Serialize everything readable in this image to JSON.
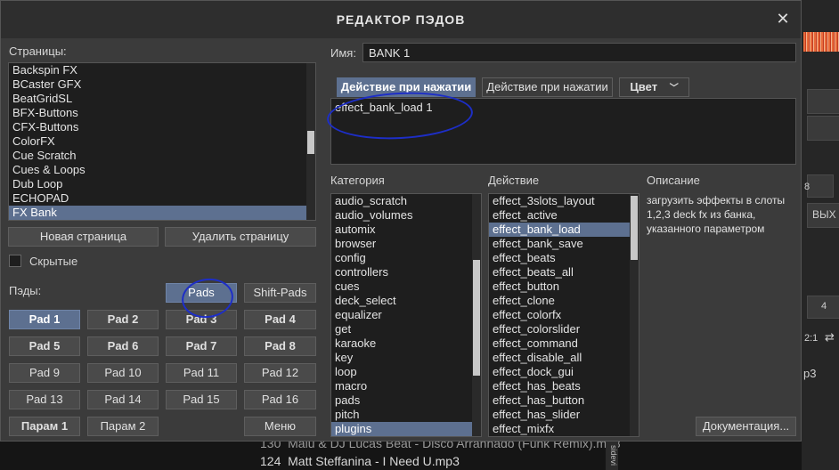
{
  "dialog": {
    "title": "РЕДАКТОР ПЭДОВ",
    "close_label": "✕"
  },
  "pages": {
    "label": "Страницы:",
    "items": [
      "Backspin FX",
      "BCaster GFX",
      "BeatGridSL",
      "BFX-Buttons",
      "CFX-Buttons",
      "ColorFX",
      "Cue Scratch",
      "Cues & Loops",
      "Dub Loop",
      "ECHOPAD",
      "FX Bank"
    ],
    "selected": "FX Bank",
    "new_page_label": "Новая страница",
    "delete_page_label": "Удалить страницу",
    "hidden_label": "Скрытые",
    "hidden_checked": false
  },
  "pads": {
    "label": "Пэды:",
    "mode_tabs": [
      "Pads",
      "Shift-Pads"
    ],
    "mode_selected": "Pads",
    "buttons": [
      "Pad 1",
      "Pad 2",
      "Pad 3",
      "Pad 4",
      "Pad 5",
      "Pad 6",
      "Pad 7",
      "Pad 8",
      "Pad 9",
      "Pad 10",
      "Pad 11",
      "Pad 12",
      "Pad 13",
      "Pad 14",
      "Pad 15",
      "Pad 16"
    ],
    "selected": "Pad 1",
    "param_label": "Парам 1",
    "param2_label": "Парам 2",
    "menu_label": "Меню"
  },
  "editor": {
    "name_label": "Имя:",
    "name_value": "BANK 1",
    "action_tabs": [
      "Действие при нажатии",
      "Действие при нажатии"
    ],
    "color_label": "Цвет",
    "script": "effect_bank_load 1"
  },
  "category": {
    "label": "Категория",
    "items": [
      "audio_scratch",
      "audio_volumes",
      "automix",
      "browser",
      "config",
      "controllers",
      "cues",
      "deck_select",
      "equalizer",
      "get",
      "karaoke",
      "key",
      "loop",
      "macro",
      "pads",
      "pitch",
      "plugins"
    ],
    "selected": "plugins"
  },
  "action": {
    "label": "Действие",
    "items": [
      "effect_3slots_layout",
      "effect_active",
      "effect_bank_load",
      "effect_bank_save",
      "effect_beats",
      "effect_beats_all",
      "effect_button",
      "effect_clone",
      "effect_colorfx",
      "effect_colorslider",
      "effect_command",
      "effect_disable_all",
      "effect_dock_gui",
      "effect_has_beats",
      "effect_has_button",
      "effect_has_slider",
      "effect_mixfx"
    ],
    "selected": "effect_bank_load"
  },
  "description": {
    "label": "Описание",
    "text": "загрузить эффекты в слоты 1,2,3 deck fx из банка, указанного параметром",
    "docs_label": "Документация..."
  },
  "background": {
    "rows": [
      {
        "num": "130",
        "title": "Malu & DJ Lucas Beat - Disco Arranhado (Funk Remix).mp3"
      },
      {
        "num": "124",
        "title": "Matt Steffanina - I Need U.mp3"
      }
    ],
    "side_text": "sidevi",
    "right_labels": [
      "8",
      "4",
      "2:1",
      "ВЫХ",
      "р3"
    ]
  },
  "colors": {
    "accent": "#5d7090",
    "annotation": "#1d2ec7"
  }
}
